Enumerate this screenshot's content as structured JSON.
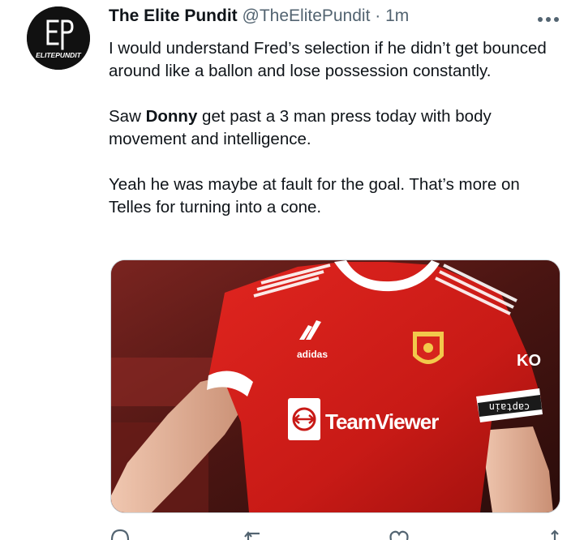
{
  "tweet": {
    "display_name": "The Elite Pundit",
    "handle": "@TheElitePundit",
    "separator": "·",
    "time": "1m",
    "avatar": {
      "monogram": "EP",
      "wordmark": "ELITEPUNDIT"
    },
    "more_icon": "more-horizontal-icon",
    "paragraphs": {
      "p1": "I would understand Fred’s selection if he didn’t get bounced around like a ballon and lose possession constantly.",
      "p2_before": "Saw ",
      "p2_bold": "Donny",
      "p2_after": " get past a 3 man press today with body movement and intelligence.",
      "p3": "Yeah he was maybe at fault for the goal. That’s more on Telles for turning into a cone."
    },
    "media": {
      "type": "photo",
      "sleeve_text": "KO",
      "sponsor_text": "TeamViewer",
      "brand_text": "adidas",
      "armband_text": "captain"
    },
    "actions": [
      "reply-icon",
      "retweet-icon",
      "like-icon",
      "share-icon"
    ]
  }
}
